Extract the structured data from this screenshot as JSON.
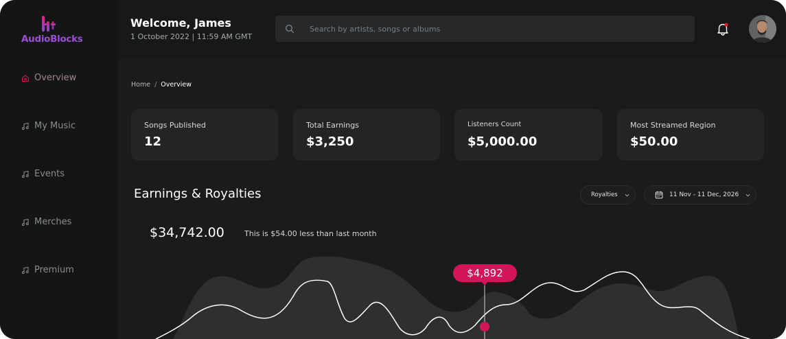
{
  "brand": {
    "name": "AudioBlocks",
    "color": "#9a4fd6"
  },
  "sidebar": {
    "items": [
      {
        "label": "Overview",
        "icon": "home-icon",
        "active": true
      },
      {
        "label": "My Music",
        "icon": "music-note-icon",
        "active": false
      },
      {
        "label": "Events",
        "icon": "music-note-icon",
        "active": false
      },
      {
        "label": "Merches",
        "icon": "music-note-icon",
        "active": false
      },
      {
        "label": "Premium",
        "icon": "music-note-icon",
        "active": false
      }
    ]
  },
  "header": {
    "welcome": "Welcome, James",
    "datetime": "1 October  2022 | 11:59 AM GMT",
    "search_placeholder": "Search by artists, songs or albums",
    "notification_icon": "bell-icon",
    "notification_dot_color": "#e0202e"
  },
  "breadcrumb": {
    "home": "Home",
    "separator": "/",
    "current": "Overview"
  },
  "stats": [
    {
      "label": "Songs Published",
      "value": "12"
    },
    {
      "label": "Total Earnings",
      "value": "$3,250"
    },
    {
      "label": "Listeners Count",
      "value": "$5,000.00"
    },
    {
      "label": "Most Streamed Region",
      "value": "$50.00"
    }
  ],
  "earnings": {
    "title": "Earnings & Royalties",
    "filter": "Royalties",
    "date_range": "11 Nov - 11 Dec, 2026",
    "total": "$34,742.00",
    "comparison": "This is $54.00 less than last month",
    "tooltip": "$4,892",
    "accent_color": "#d4145a"
  }
}
